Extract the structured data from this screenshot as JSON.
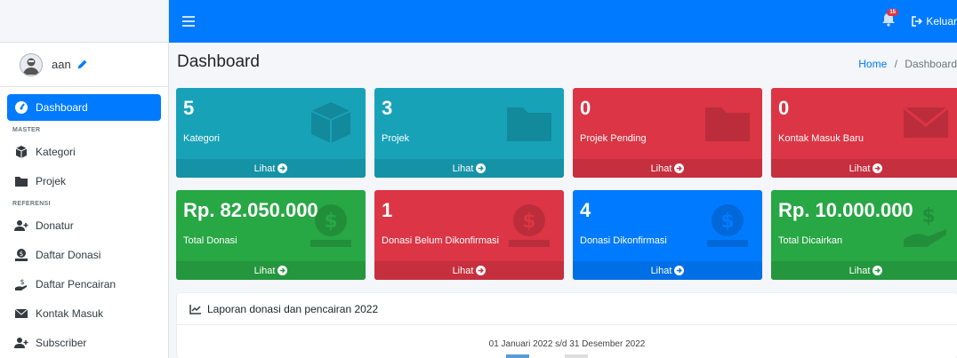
{
  "user": {
    "name": "aan"
  },
  "topbar": {
    "notif_count": "15",
    "logout_label": "Keluar"
  },
  "page": {
    "title": "Dashboard",
    "breadcrumb_home": "Home",
    "breadcrumb_sep": "/",
    "breadcrumb_current": "Dashboard"
  },
  "sidebar": {
    "dashboard": "Dashboard",
    "header_master": "MASTER",
    "kategori": "Kategori",
    "projek": "Projek",
    "header_referensi": "REFERENSI",
    "donatur": "Donatur",
    "daftar_donasi": "Daftar Donasi",
    "daftar_pencairan": "Daftar Pencairan",
    "kontak_masuk": "Kontak Masuk",
    "subscriber": "Subscriber"
  },
  "boxes": [
    {
      "value": "5",
      "label": "Kategori",
      "link": "Lihat",
      "color": "#17a2b8",
      "icon": "box-icon"
    },
    {
      "value": "3",
      "label": "Projek",
      "link": "Lihat",
      "color": "#17a2b8",
      "icon": "folder-icon"
    },
    {
      "value": "0",
      "label": "Projek Pending",
      "link": "Lihat",
      "color": "#dc3545",
      "icon": "folder-icon"
    },
    {
      "value": "0",
      "label": "Kontak Masuk Baru",
      "link": "Lihat",
      "color": "#dc3545",
      "icon": "envelope-icon"
    },
    {
      "value": "Rp. 82.050.000",
      "label": "Total Donasi",
      "link": "Lihat",
      "color": "#28a745",
      "icon": "donate-icon"
    },
    {
      "value": "1",
      "label": "Donasi Belum Dikonfirmasi",
      "link": "Lihat",
      "color": "#dc3545",
      "icon": "donate-icon"
    },
    {
      "value": "4",
      "label": "Donasi Dikonfirmasi",
      "link": "Lihat",
      "color": "#007bff",
      "icon": "donate-icon"
    },
    {
      "value": "Rp. 10.000.000",
      "label": "Total Dicairkan",
      "link": "Lihat",
      "color": "#28a745",
      "icon": "hand-holding-usd-icon"
    }
  ],
  "report": {
    "title": "Laporan donasi dan pencairan 2022",
    "period": "01 Januari 2022 s/d 31 Desember 2022"
  }
}
